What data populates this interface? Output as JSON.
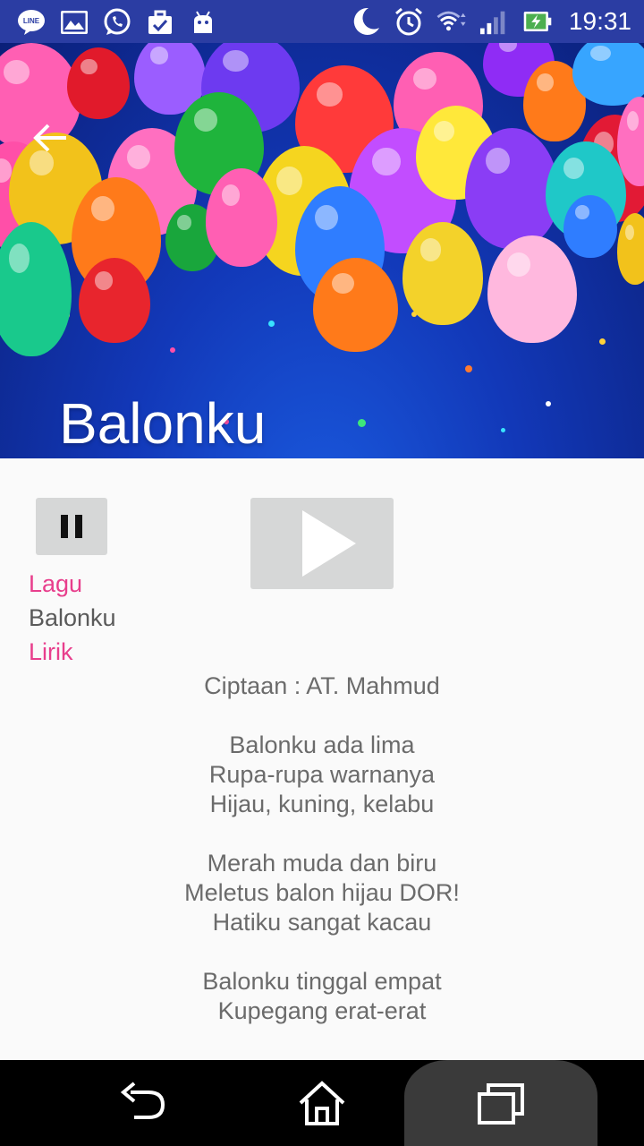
{
  "status_bar": {
    "time": "19:31",
    "left_icons": [
      "line-icon",
      "gallery-icon",
      "whatsapp-icon",
      "briefcase-check-icon",
      "android-icon"
    ],
    "right_icons": [
      "moon-icon",
      "alarm-icon",
      "wifi-icon",
      "signal-icon",
      "battery-charging-icon"
    ]
  },
  "header": {
    "title": "Balonku",
    "back_icon": "arrow-back-icon"
  },
  "player": {
    "pause_icon": "pause-icon",
    "play_icon": "play-icon"
  },
  "song": {
    "lagu_label": "Lagu",
    "lagu_value": "Balonku",
    "lirik_label": "Lirik",
    "composer": "Ciptaan : AT. Mahmud",
    "verses": [
      [
        "Balonku ada lima",
        "Rupa-rupa warnanya",
        "Hijau, kuning, kelabu"
      ],
      [
        "Merah muda dan biru",
        "Meletus balon hijau DOR!",
        "Hatiku sangat kacau"
      ],
      [
        "Balonku tinggal empat",
        "Kupegang erat-erat"
      ]
    ]
  },
  "nav_bar": {
    "back_icon": "nav-back-icon",
    "home_icon": "home-icon",
    "recents_icon": "recents-icon"
  },
  "colors": {
    "status_bar": "#2b3da3",
    "accent_pink": "#e83e8c",
    "button_gray": "#d6d7d7"
  }
}
